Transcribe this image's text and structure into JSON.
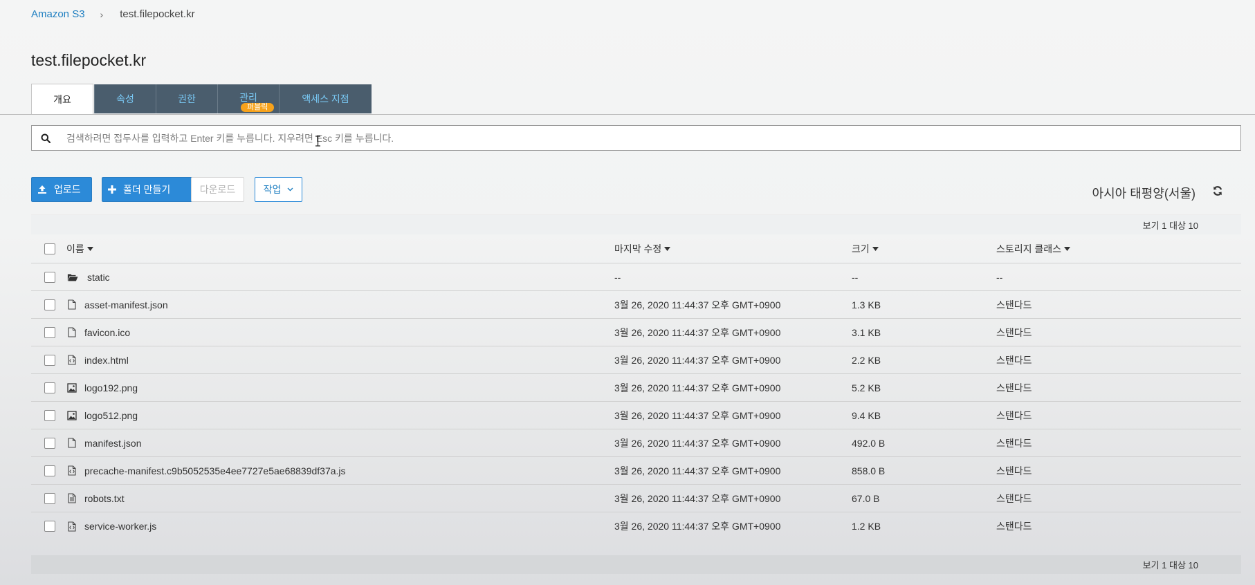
{
  "breadcrumb": {
    "root": "Amazon S3",
    "current": "test.filepocket.kr"
  },
  "page_title": "test.filepocket.kr",
  "tabs": [
    {
      "label": "개요",
      "active": true
    },
    {
      "label": "속성"
    },
    {
      "label": "권한"
    },
    {
      "label": "관리",
      "badge": "퍼블릭"
    },
    {
      "label": "액세스 지점"
    }
  ],
  "search": {
    "placeholder": "검색하려면 접두사를 입력하고 Enter 키를 누릅니다. 지우려면 Esc 키를 누릅니다.",
    "value": ""
  },
  "toolbar": {
    "upload": "업로드",
    "create_folder": "폴더 만들기",
    "download": "다운로드",
    "actions": "작업",
    "region": "아시아 태평양(서울)"
  },
  "pagination": {
    "top": "보기 1 대상 10",
    "bottom": "보기 1 대상 10"
  },
  "columns": {
    "name": "이름",
    "modified": "마지막 수정",
    "size": "크기",
    "storage_class": "스토리지 클래스"
  },
  "rows": [
    {
      "icon": "folder-icon",
      "name": "static",
      "modified": "--",
      "size": "--",
      "storage_class": "--"
    },
    {
      "icon": "file-icon",
      "name": "asset-manifest.json",
      "modified": "3월 26, 2020 11:44:37 오후 GMT+0900",
      "size": "1.3 KB",
      "storage_class": "스탠다드"
    },
    {
      "icon": "file-icon",
      "name": "favicon.ico",
      "modified": "3월 26, 2020 11:44:37 오후 GMT+0900",
      "size": "3.1 KB",
      "storage_class": "스탠다드"
    },
    {
      "icon": "code-file-icon",
      "name": "index.html",
      "modified": "3월 26, 2020 11:44:37 오후 GMT+0900",
      "size": "2.2 KB",
      "storage_class": "스탠다드"
    },
    {
      "icon": "image-file-icon",
      "name": "logo192.png",
      "modified": "3월 26, 2020 11:44:37 오후 GMT+0900",
      "size": "5.2 KB",
      "storage_class": "스탠다드"
    },
    {
      "icon": "image-file-icon",
      "name": "logo512.png",
      "modified": "3월 26, 2020 11:44:37 오후 GMT+0900",
      "size": "9.4 KB",
      "storage_class": "스탠다드"
    },
    {
      "icon": "file-icon",
      "name": "manifest.json",
      "modified": "3월 26, 2020 11:44:37 오후 GMT+0900",
      "size": "492.0 B",
      "storage_class": "스탠다드"
    },
    {
      "icon": "code-file-icon",
      "name": "precache-manifest.c9b5052535e4ee7727e5ae68839df37a.js",
      "modified": "3월 26, 2020 11:44:37 오후 GMT+0900",
      "size": "858.0 B",
      "storage_class": "스탠다드"
    },
    {
      "icon": "text-file-icon",
      "name": "robots.txt",
      "modified": "3월 26, 2020 11:44:37 오후 GMT+0900",
      "size": "67.0 B",
      "storage_class": "스탠다드"
    },
    {
      "icon": "code-file-icon",
      "name": "service-worker.js",
      "modified": "3월 26, 2020 11:44:37 오후 GMT+0900",
      "size": "1.2 KB",
      "storage_class": "스탠다드"
    }
  ]
}
